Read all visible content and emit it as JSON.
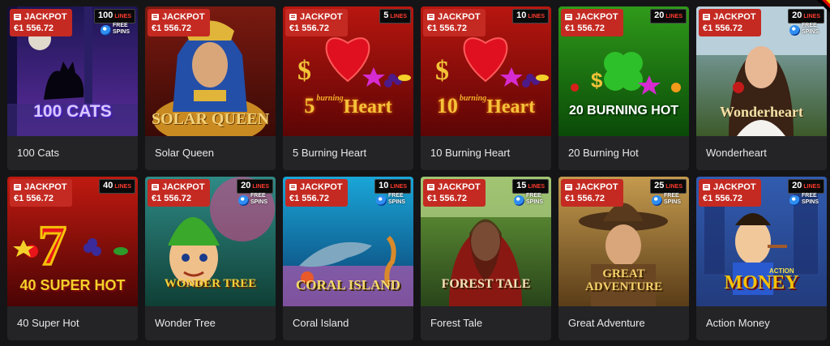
{
  "jackpot": {
    "label": "JACKPOT",
    "amount": "€1 556.72"
  },
  "free_spins": {
    "line1": "FREE",
    "line2": "SPINS"
  },
  "games": [
    {
      "name": "100 Cats",
      "lines": "100",
      "lines_label": "LINES",
      "free_spins": true,
      "art_title": "100 CATS",
      "colors": [
        "#1d1654",
        "#5b2c9c"
      ]
    },
    {
      "name": "Solar Queen",
      "lines": "",
      "lines_label": "",
      "free_spins": false,
      "art_title": "SOLAR QUEEN",
      "colors": [
        "#7a1a10",
        "#3a0a06"
      ]
    },
    {
      "name": "5 Burning Heart",
      "lines": "5",
      "lines_label": "LINES",
      "free_spins": false,
      "art_title": "5",
      "art_sub": "Heart",
      "art_burn": "burning",
      "colors": [
        "#b8160f",
        "#5c0505"
      ]
    },
    {
      "name": "10 Burning Heart",
      "lines": "10",
      "lines_label": "LINES",
      "free_spins": false,
      "art_title": "10",
      "art_sub": "Heart",
      "art_burn": "burning",
      "colors": [
        "#b8160f",
        "#5c0505"
      ]
    },
    {
      "name": "20 Burning Hot",
      "lines": "20",
      "lines_label": "LINES",
      "free_spins": false,
      "art_title": "20 BURNING HOT",
      "colors": [
        "#2f9a1a",
        "#0a4a08"
      ]
    },
    {
      "name": "Wonderheart",
      "lines": "20",
      "lines_label": "LINES",
      "free_spins": true,
      "art_title": "Wonderheart",
      "colors": [
        "#8fb4c8",
        "#3c5a2a"
      ]
    },
    {
      "name": "40 Super Hot",
      "lines": "40",
      "lines_label": "LINES",
      "free_spins": false,
      "art_title": "40 SUPER HOT",
      "colors": [
        "#c01a10",
        "#4a0404"
      ]
    },
    {
      "name": "Wonder Tree",
      "lines": "20",
      "lines_label": "LINES",
      "free_spins": true,
      "art_title": "WONDER TREE",
      "colors": [
        "#2f8a86",
        "#0f3f35"
      ]
    },
    {
      "name": "Coral Island",
      "lines": "10",
      "lines_label": "LINES",
      "free_spins": true,
      "art_title": "CORAL ISLAND",
      "colors": [
        "#1aa6d8",
        "#0a3d6e"
      ]
    },
    {
      "name": "Forest Tale",
      "lines": "15",
      "lines_label": "LINES",
      "free_spins": true,
      "art_title": "FOREST TALE",
      "colors": [
        "#6aa03a",
        "#28441a"
      ]
    },
    {
      "name": "Great Adventure",
      "lines": "25",
      "lines_label": "LINES",
      "free_spins": true,
      "art_title": "GREAT ADVENTURE",
      "colors": [
        "#c49a4e",
        "#5a3d18"
      ]
    },
    {
      "name": "Action Money",
      "lines": "20",
      "lines_label": "LINES",
      "free_spins": true,
      "art_title": "MONEY",
      "art_small": "ACTION",
      "colors": [
        "#3a6ed0",
        "#1a2d6a"
      ]
    }
  ]
}
